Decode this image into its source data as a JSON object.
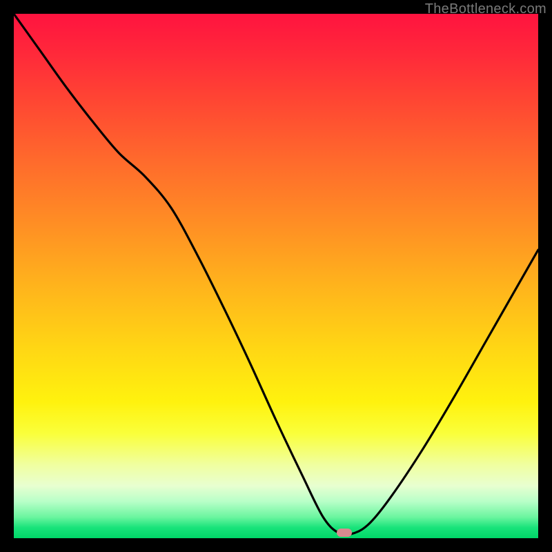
{
  "watermark": "TheBottleneck.com",
  "marker": {
    "x_frac": 0.63,
    "y_frac": 0.99
  },
  "chart_data": {
    "type": "line",
    "title": "",
    "xlabel": "",
    "ylabel": "",
    "xlim": [
      0,
      1
    ],
    "ylim": [
      0,
      1
    ],
    "background": "red-yellow-green vertical gradient",
    "annotations": [
      {
        "type": "marker",
        "shape": "rounded-pill",
        "color": "#d98a8f",
        "x": 0.63,
        "y": 0.01
      }
    ],
    "series": [
      {
        "name": "bottleneck-curve",
        "color": "#000000",
        "x": [
          0.0,
          0.05,
          0.1,
          0.15,
          0.2,
          0.25,
          0.3,
          0.35,
          0.4,
          0.45,
          0.5,
          0.55,
          0.59,
          0.62,
          0.65,
          0.68,
          0.72,
          0.78,
          0.84,
          0.9,
          0.96,
          1.0
        ],
        "y_frac": [
          0.0,
          0.07,
          0.14,
          0.205,
          0.265,
          0.31,
          0.37,
          0.46,
          0.56,
          0.665,
          0.775,
          0.88,
          0.96,
          0.99,
          0.99,
          0.97,
          0.92,
          0.83,
          0.73,
          0.625,
          0.52,
          0.45
        ],
        "note": "y_frac is fraction from TOP of plot area (0=top, 1=bottom). Actual metric scale not shown in source image."
      }
    ]
  }
}
